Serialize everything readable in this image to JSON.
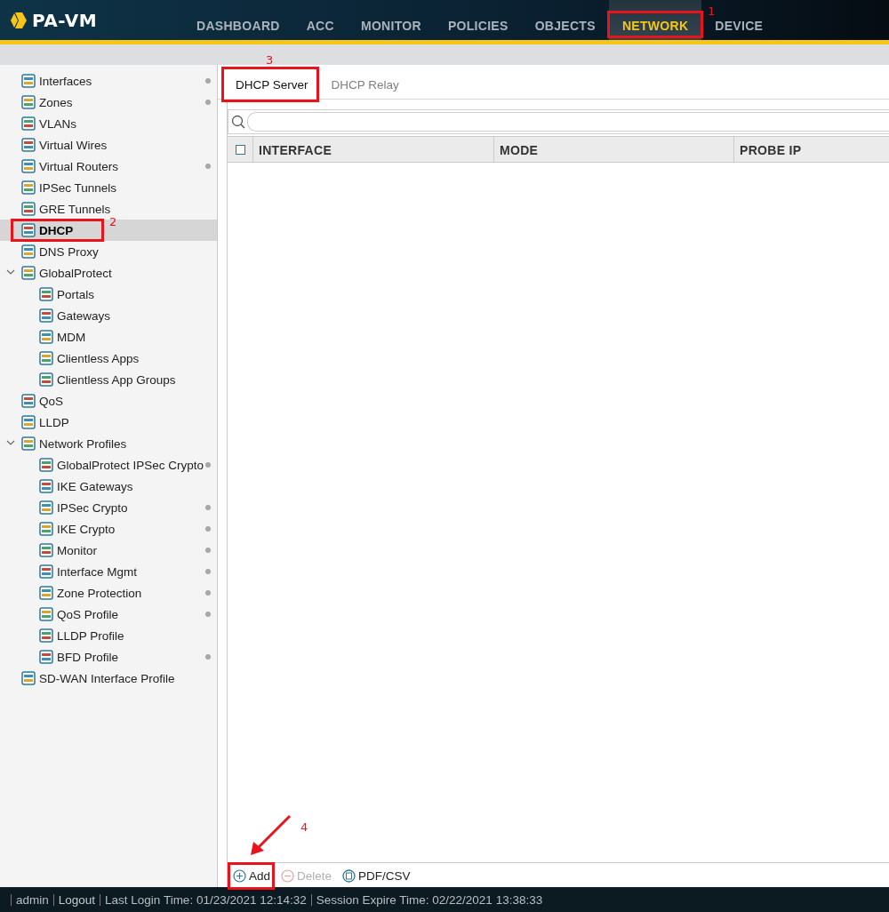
{
  "header": {
    "product": "PA-VM",
    "nav": [
      {
        "label": "DASHBOARD",
        "selected": false
      },
      {
        "label": "ACC",
        "selected": false
      },
      {
        "label": "MONITOR",
        "selected": false
      },
      {
        "label": "POLICIES",
        "selected": false
      },
      {
        "label": "OBJECTS",
        "selected": false
      },
      {
        "label": "NETWORK",
        "selected": true,
        "annotation": {
          "number": "1"
        }
      },
      {
        "label": "DEVICE",
        "selected": false
      }
    ]
  },
  "sidebar": {
    "items": [
      {
        "label": "Interfaces",
        "selected": false,
        "marked": true
      },
      {
        "label": "Zones",
        "selected": false,
        "marked": true
      },
      {
        "label": "VLANs",
        "selected": false
      },
      {
        "label": "Virtual Wires",
        "selected": false
      },
      {
        "label": "Virtual Routers",
        "selected": false,
        "marked": true
      },
      {
        "label": "IPSec Tunnels",
        "selected": false
      },
      {
        "label": "GRE Tunnels",
        "selected": false
      },
      {
        "label": "DHCP",
        "selected": true,
        "annotation": {
          "number": "2"
        }
      },
      {
        "label": "DNS Proxy",
        "selected": false
      },
      {
        "label": "GlobalProtect",
        "selected": false,
        "expanded": true,
        "children": [
          {
            "label": "Portals",
            "selected": false
          },
          {
            "label": "Gateways",
            "selected": false
          },
          {
            "label": "MDM",
            "selected": false
          },
          {
            "label": "Clientless Apps",
            "selected": false
          },
          {
            "label": "Clientless App Groups",
            "selected": false
          }
        ]
      },
      {
        "label": "QoS",
        "selected": false
      },
      {
        "label": "LLDP",
        "selected": false
      },
      {
        "label": "Network Profiles",
        "selected": false,
        "expanded": true,
        "children": [
          {
            "label": "GlobalProtect IPSec Crypto",
            "selected": false,
            "marked": true
          },
          {
            "label": "IKE Gateways",
            "selected": false
          },
          {
            "label": "IPSec Crypto",
            "selected": false,
            "marked": true
          },
          {
            "label": "IKE Crypto",
            "selected": false,
            "marked": true
          },
          {
            "label": "Monitor",
            "selected": false,
            "marked": true
          },
          {
            "label": "Interface Mgmt",
            "selected": false,
            "marked": true
          },
          {
            "label": "Zone Protection",
            "selected": false,
            "marked": true
          },
          {
            "label": "QoS Profile",
            "selected": false,
            "marked": true
          },
          {
            "label": "LLDP Profile",
            "selected": false
          },
          {
            "label": "BFD Profile",
            "selected": false,
            "marked": true
          }
        ]
      },
      {
        "label": "SD-WAN Interface Profile",
        "selected": false
      }
    ]
  },
  "main": {
    "tabs": [
      {
        "label": "DHCP Server",
        "selected": true,
        "annotation": {
          "number": "3"
        }
      },
      {
        "label": "DHCP Relay",
        "selected": false
      }
    ],
    "table": {
      "columns": [
        "INTERFACE",
        "MODE",
        "PROBE IP"
      ],
      "select_all": false
    },
    "toolbar": [
      {
        "kind": "add",
        "label": "Add",
        "disabled": false,
        "annotation": {
          "number": "4",
          "arrow": true
        }
      },
      {
        "kind": "delete",
        "label": "Delete",
        "disabled": true
      },
      {
        "kind": "export",
        "label": "PDF/CSV",
        "disabled": false
      }
    ]
  },
  "status_bar": {
    "user": "admin",
    "logout": "Logout",
    "last_login": "Last Login Time: 01/23/2021 12:14:32",
    "session_expire": "Session Expire Time: 02/22/2021 13:38:33"
  }
}
